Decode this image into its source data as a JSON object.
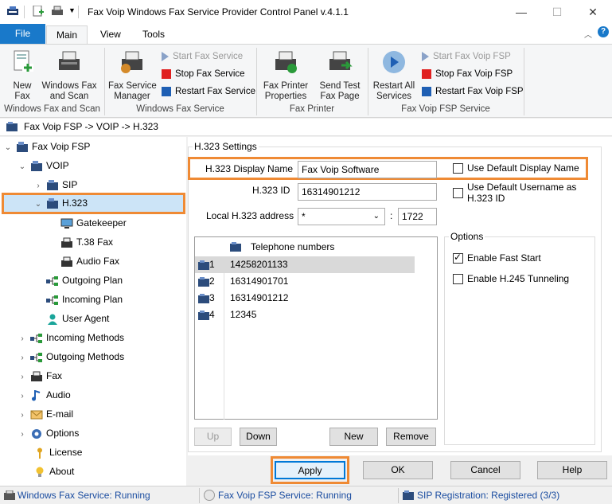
{
  "window": {
    "title": "Fax Voip Windows Fax Service Provider Control Panel v.4.1.1",
    "controls": {
      "minimize": "—",
      "maximize": "☐",
      "close": "✕"
    }
  },
  "ribbon": {
    "tabs": [
      {
        "label": "File"
      },
      {
        "label": "Main"
      },
      {
        "label": "View"
      },
      {
        "label": "Tools"
      }
    ],
    "groups": {
      "windows_fax_and_scan": {
        "label": "Windows Fax and Scan",
        "new_fax": "New\nFax",
        "wfs": "Windows Fax\nand Scan"
      },
      "windows_fax_service": {
        "label": "Windows Fax Service",
        "manager": "Fax Service\nManager",
        "start": "Start Fax Service",
        "stop": "Stop Fax Service",
        "restart": "Restart Fax Service"
      },
      "fax_printer": {
        "label": "Fax Printer",
        "properties": "Fax Printer\nProperties",
        "test": "Send Test\nFax Page"
      },
      "fax_voip_fsp_service": {
        "label": "Fax Voip FSP Service",
        "restart_all": "Restart All\nServices",
        "start": "Start Fax Voip FSP",
        "stop": "Stop Fax Voip FSP",
        "restart": "Restart Fax Voip FSP"
      }
    }
  },
  "breadcrumb": "Fax Voip FSP -> VOIP -> H.323",
  "tree": [
    {
      "label": "Fax Voip FSP"
    },
    {
      "label": "VOIP"
    },
    {
      "label": "SIP"
    },
    {
      "label": "H.323"
    },
    {
      "label": "Gatekeeper"
    },
    {
      "label": "T.38 Fax"
    },
    {
      "label": "Audio Fax"
    },
    {
      "label": "Outgoing Plan"
    },
    {
      "label": "Incoming Plan"
    },
    {
      "label": "User Agent"
    },
    {
      "label": "Incoming Methods"
    },
    {
      "label": "Outgoing Methods"
    },
    {
      "label": "Fax"
    },
    {
      "label": "Audio"
    },
    {
      "label": "E-mail"
    },
    {
      "label": "Options"
    },
    {
      "label": "License"
    },
    {
      "label": "About"
    }
  ],
  "settings": {
    "group_title": "H.323 Settings",
    "display_name_label": "H.323 Display Name",
    "display_name_value": "Fax Voip Software",
    "use_default_display_name": "Use Default Display Name",
    "h323_id_label": "H.323 ID",
    "h323_id_value": "16314901212",
    "use_default_username": "Use Default Username as H.323 ID",
    "local_address_label": "Local H.323 address",
    "local_address_value": "*",
    "port_separator": ":",
    "port_value": "1722",
    "options_title": "Options",
    "fast_start": "Enable Fast Start",
    "h245_tunneling": "Enable H.245 Tunneling",
    "fast_start_checked": true,
    "h245_tunneling_checked": false,
    "use_default_display_name_checked": false,
    "use_default_username_checked": false
  },
  "telephone_list": {
    "header": "Telephone numbers",
    "rows": [
      {
        "index": "1",
        "number": "14258201133"
      },
      {
        "index": "2",
        "number": "16314901701"
      },
      {
        "index": "3",
        "number": "16314901212"
      },
      {
        "index": "4",
        "number": "12345"
      }
    ]
  },
  "buttons": {
    "up": "Up",
    "down": "Down",
    "new": "New",
    "remove": "Remove",
    "apply": "Apply",
    "ok": "OK",
    "cancel": "Cancel",
    "help": "Help"
  },
  "status": {
    "windows_fax": "Windows Fax Service: Running",
    "fsp": "Fax Voip FSP Service: Running",
    "sip": "SIP Registration: Registered (3/3)"
  },
  "colors": {
    "highlight": "#ef8a34",
    "accent": "#1979ca",
    "selection": "#cce4f7"
  }
}
